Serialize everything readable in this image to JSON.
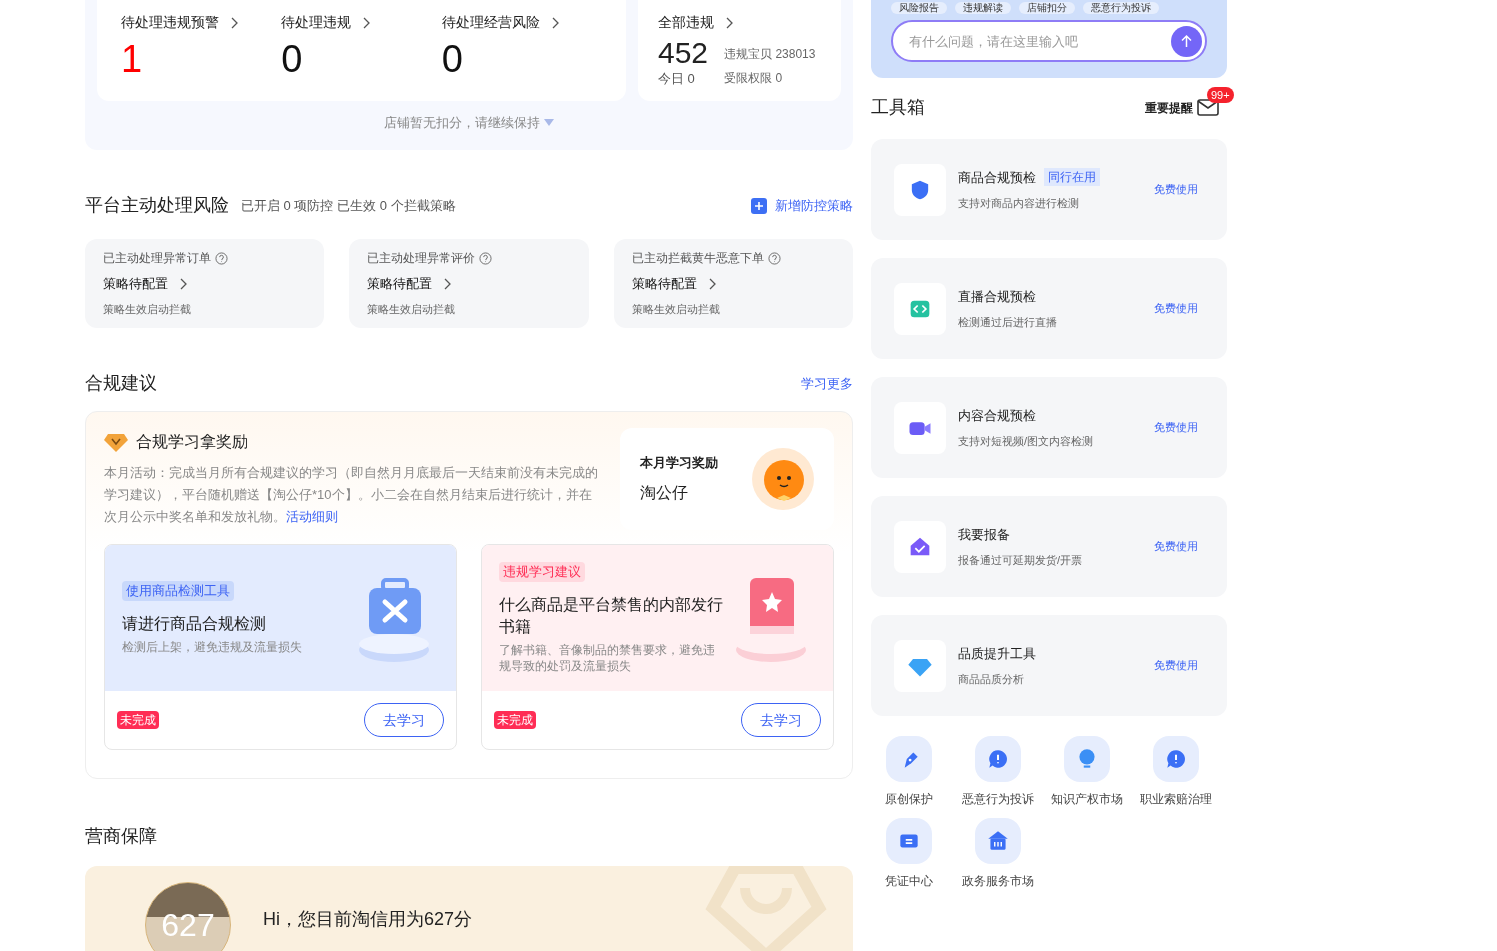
{
  "stats": {
    "items": [
      {
        "label": "待处理违规预警",
        "value": "1",
        "alert": true
      },
      {
        "label": "待处理违规",
        "value": "0",
        "alert": false
      },
      {
        "label": "待处理经营风险",
        "value": "0",
        "alert": false
      }
    ],
    "total": {
      "label": "全部违规",
      "value": "452",
      "today": "今日 0",
      "items": "违规宝贝 238013",
      "limited": "受限权限 0"
    },
    "footer": "店铺暂无扣分，请继续保持"
  },
  "risk": {
    "title": "平台主动处理风险",
    "summary": "已开启 0 项防控 已生效 0 个拦截策略",
    "action": "新增防控策略",
    "cards": [
      {
        "title": "已主动处理异常订单",
        "status": "策略待配置",
        "note": "策略生效启动拦截"
      },
      {
        "title": "已主动处理异常评价",
        "status": "策略待配置",
        "note": "策略生效启动拦截"
      },
      {
        "title": "已主动拦截黄牛恶意下单",
        "status": "策略待配置",
        "note": "策略生效启动拦截"
      }
    ]
  },
  "advice": {
    "title": "合规建议",
    "more": "学习更多",
    "reward_title": "合规学习拿奖励",
    "reward_text": "本月活动：完成当月所有合规建议的学习（即自然月月底最后一天结束前没有未完成的学习建议），平台随机赠送【淘公仔*10个】。小二会在自然月结束后进行统计，并在次月公示中奖名单和发放礼物。",
    "reward_link": "活动细则",
    "prize_label": "本月学习奖励",
    "prize": "淘公仔",
    "cards": [
      {
        "kind": "tool",
        "tag": "使用商品检测工具",
        "title": "请进行商品合规检测",
        "desc": "检测后上架，避免违规及流量损失",
        "status": "未完成",
        "button": "去学习"
      },
      {
        "kind": "book",
        "tag": "违规学习建议",
        "title": "什么商品是平台禁售的内部发行书籍",
        "desc": "了解书籍、音像制品的禁售要求，避免违规导致的处罚及流量损失",
        "status": "未完成",
        "button": "去学习"
      }
    ]
  },
  "guarantee": {
    "title": "营商保障",
    "score": "627",
    "greeting": "Hi，您目前淘信用为627分"
  },
  "assistant": {
    "chips": [
      "风险报告",
      "违规解读",
      "店铺扣分",
      "恶意行为投诉"
    ],
    "placeholder": "有什么问题，请在这里输入吧"
  },
  "toolbox": {
    "title": "工具箱",
    "reminder": "重要提醒",
    "badge": "99+",
    "tools": [
      {
        "kind": "shield",
        "name": "商品合规预检",
        "tag": "同行在用",
        "desc": "支持对商品内容进行检测",
        "action": "免费使用"
      },
      {
        "kind": "code",
        "name": "直播合规预检",
        "desc": "检测通过后进行直播",
        "action": "免费使用"
      },
      {
        "kind": "video",
        "name": "内容合规预检",
        "desc": "支持对短视频/图文内容检测",
        "action": "免费使用"
      },
      {
        "kind": "report",
        "name": "我要报备",
        "desc": "报备通过可延期发货/开票",
        "action": "免费使用"
      },
      {
        "kind": "diamond",
        "name": "品质提升工具",
        "desc": "商品品质分析",
        "action": "免费使用"
      }
    ],
    "shortcuts": [
      {
        "kind": "pen",
        "label": "原创保护"
      },
      {
        "kind": "alert",
        "label": "恶意行为投诉"
      },
      {
        "kind": "bulb",
        "label": "知识产权市场"
      },
      {
        "kind": "alert",
        "label": "职业索赔治理"
      },
      {
        "kind": "ticket",
        "label": "凭证中心"
      },
      {
        "kind": "house",
        "label": "政务服务市场"
      }
    ]
  }
}
